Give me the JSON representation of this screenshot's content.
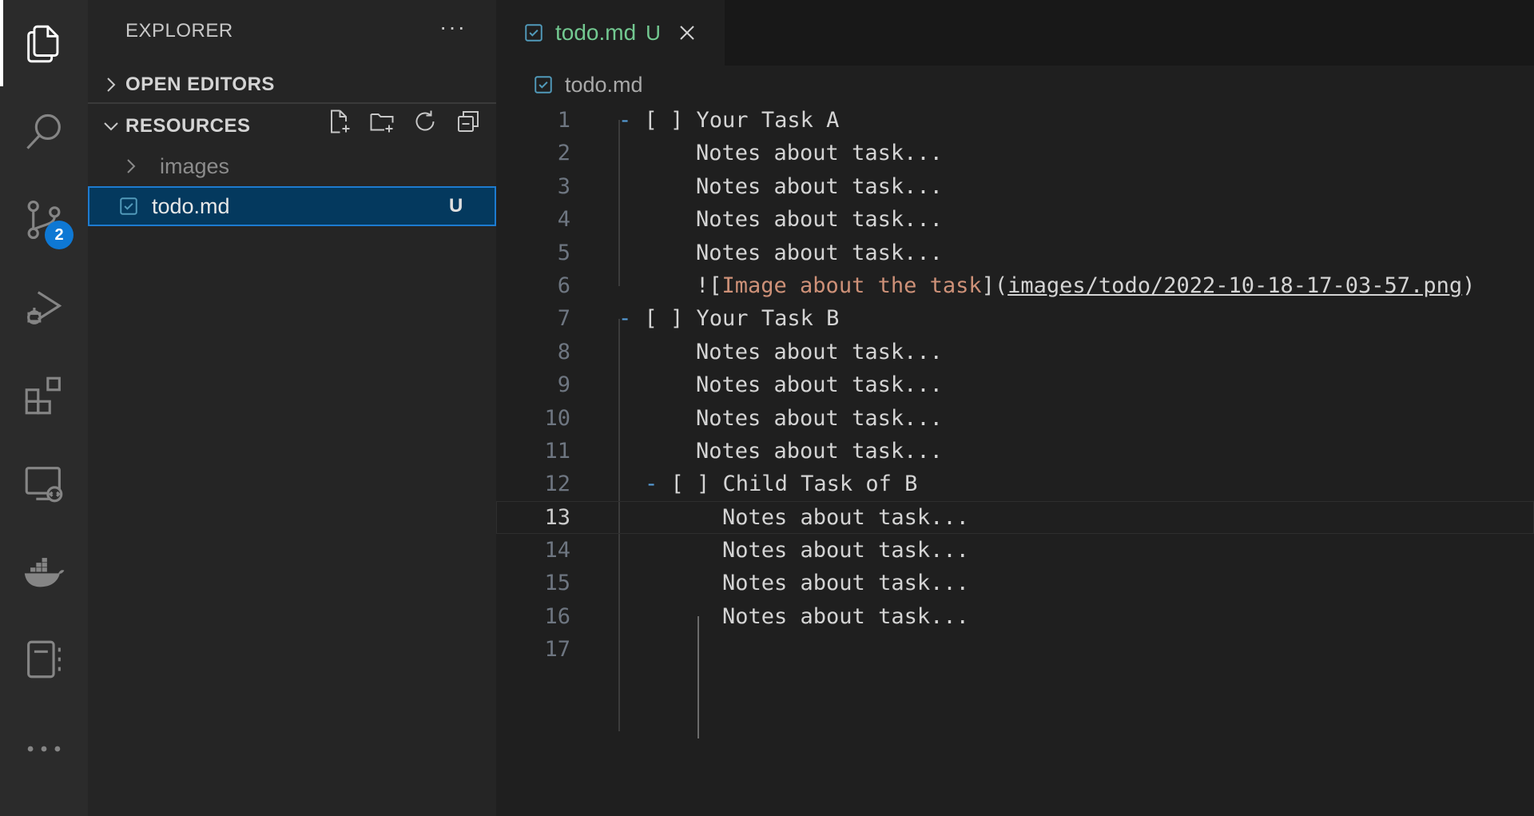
{
  "activity_bar": {
    "items": [
      {
        "icon": "files-icon",
        "name": "explorer"
      },
      {
        "icon": "search-icon",
        "name": "search"
      },
      {
        "icon": "source-control-icon",
        "name": "source-control"
      },
      {
        "icon": "run-debug-icon",
        "name": "run-debug"
      },
      {
        "icon": "extensions-icon",
        "name": "extensions"
      },
      {
        "icon": "remote-explorer-icon",
        "name": "remote-explorer"
      },
      {
        "icon": "docker-icon",
        "name": "docker"
      },
      {
        "icon": "notebook-icon",
        "name": "notebook"
      },
      {
        "icon": "more-icon",
        "name": "more"
      }
    ],
    "source_control_badge": "2"
  },
  "sidebar": {
    "title": "EXPLORER",
    "more_label": "···",
    "open_editors_label": "OPEN EDITORS",
    "resources_label": "RESOURCES",
    "tree": [
      {
        "name": "images",
        "type": "folder"
      },
      {
        "name": "todo.md",
        "type": "file",
        "status": "U",
        "selected": true
      }
    ]
  },
  "editor": {
    "tab": {
      "label": "todo.md",
      "status": "U"
    },
    "breadcrumb": "todo.md",
    "current_line": 13,
    "lines": [
      {
        "n": "1"
      },
      {
        "n": "2"
      },
      {
        "n": "3"
      },
      {
        "n": "4"
      },
      {
        "n": "5"
      },
      {
        "n": "6"
      },
      {
        "n": "7"
      },
      {
        "n": "8"
      },
      {
        "n": "9"
      },
      {
        "n": "10"
      },
      {
        "n": "11"
      },
      {
        "n": "12"
      },
      {
        "n": "13"
      },
      {
        "n": "14"
      },
      {
        "n": "15"
      },
      {
        "n": "16"
      },
      {
        "n": "17"
      }
    ],
    "content": {
      "l1": {
        "dash": "-",
        "text": " [ ] Your Task A"
      },
      "l2": "Notes about task...",
      "l3": "Notes about task...",
      "l4": "Notes about task...",
      "l5": "Notes about task...",
      "l6": {
        "bang": "![",
        "alt": "Image about the task",
        "mid": "](",
        "url": "images/todo/2022-10-18-17-03-57.png",
        "end": ")"
      },
      "l7": {
        "dash": "-",
        "text": " [ ] Your Task B"
      },
      "l8": "Notes about task...",
      "l9": "Notes about task...",
      "l10": "Notes about task...",
      "l11": "Notes about task...",
      "l12": {
        "dash": "-",
        "text": " [ ] Child Task of B"
      },
      "l13": "Notes about task...",
      "l14": "Notes about task...",
      "l15": "Notes about task...",
      "l16": "Notes about task...",
      "l17": ""
    }
  },
  "colors": {
    "accent": "#0e78d4",
    "untracked": "#73c991",
    "link_text": "#ce9178",
    "list_marker": "#569cd6"
  }
}
